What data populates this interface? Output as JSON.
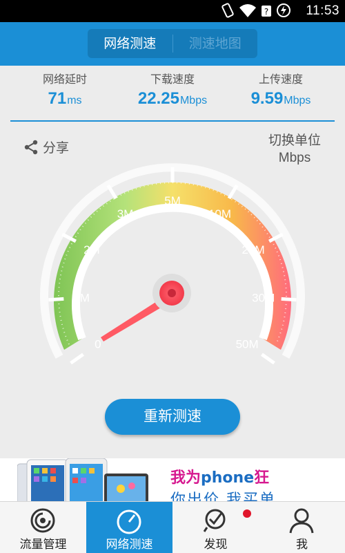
{
  "status_bar": {
    "time": "11:53",
    "icons": [
      "vibrate-icon",
      "wifi-icon",
      "data-icon",
      "battery-icon"
    ]
  },
  "header": {
    "tabs": [
      {
        "label": "网络测速",
        "active": true
      },
      {
        "label": "测速地图",
        "active": false
      }
    ]
  },
  "stats": [
    {
      "label": "网络延时",
      "value": "71",
      "unit": "ms"
    },
    {
      "label": "下载速度",
      "value": "22.25",
      "unit": "Mbps"
    },
    {
      "label": "上传速度",
      "value": "9.59",
      "unit": "Mbps"
    }
  ],
  "share": {
    "label": "分享"
  },
  "unit_switch": {
    "label": "切换单位",
    "unit": "Mbps"
  },
  "gauge": {
    "ticks": [
      "0",
      "1M",
      "2M",
      "3M",
      "5M",
      "10M",
      "20M",
      "30M",
      "50M"
    ],
    "needle_value_label": "0",
    "colors": {
      "low": "#8fd15f",
      "mid": "#f6d24a",
      "high": "#ff6b6b",
      "needle": "#ff5a64"
    }
  },
  "retest_button": {
    "label": "重新测速"
  },
  "ad": {
    "line1_a": "我为",
    "line1_b": "phone",
    "line1_c": "狂",
    "line2": "你出价 我买单"
  },
  "bottom_nav": [
    {
      "label": "流量管理",
      "icon": "traffic-icon",
      "active": false
    },
    {
      "label": "网络测速",
      "icon": "speedometer-icon",
      "active": true
    },
    {
      "label": "发现",
      "icon": "discover-icon",
      "active": false,
      "badge": true
    },
    {
      "label": "我",
      "icon": "person-icon",
      "active": false
    }
  ],
  "accent": "#1b8fd6"
}
